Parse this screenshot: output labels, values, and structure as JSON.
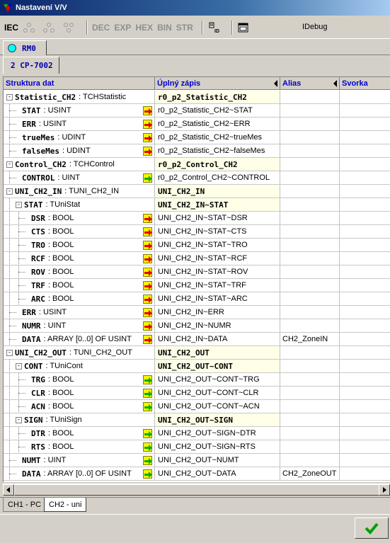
{
  "window": {
    "title": "Nastavení V/V"
  },
  "toolbar": {
    "iec": "IEC",
    "dec": "DEC",
    "exp": "EXP",
    "hex": "HEX",
    "bin": "BIN",
    "str": "STR",
    "idebug": "IDebug"
  },
  "rm_tab": {
    "label": "RM0",
    "led_color": "#00ffff"
  },
  "module_tab": {
    "label": "2 CP-7002"
  },
  "columns": {
    "structure": "Struktura dat",
    "full": "Úplný zápis",
    "alias": "Alias",
    "terminal": "Svorka"
  },
  "rows": [
    {
      "name": "Statistic_CH2",
      "type": ": TCHStatistic",
      "full": "r0_p2_Statistic_CH2",
      "alias": "",
      "level": 0,
      "expand": "-",
      "struct": true
    },
    {
      "name": "STAT",
      "type": ": USINT",
      "full": "r0_p2_Statistic_CH2~STAT",
      "alias": "",
      "level": 1,
      "io": "in"
    },
    {
      "name": "ERR",
      "type": ": USINT",
      "full": "r0_p2_Statistic_CH2~ERR",
      "alias": "",
      "level": 1,
      "io": "in"
    },
    {
      "name": "trueMes",
      "type": ": UDINT",
      "full": "r0_p2_Statistic_CH2~trueMes",
      "alias": "",
      "level": 1,
      "io": "in"
    },
    {
      "name": "falseMes",
      "type": ": UDINT",
      "full": "r0_p2_Statistic_CH2~falseMes",
      "alias": "",
      "level": 1,
      "io": "in"
    },
    {
      "name": "Control_CH2",
      "type": ": TCHControl",
      "full": "r0_p2_Control_CH2",
      "alias": "",
      "level": 0,
      "expand": "-",
      "struct": true
    },
    {
      "name": "CONTROL",
      "type": ": UINT",
      "full": "r0_p2_Control_CH2~CONTROL",
      "alias": "",
      "level": 1,
      "io": "out"
    },
    {
      "name": "UNI_CH2_IN",
      "type": ": TUNI_CH2_IN",
      "full": "UNI_CH2_IN",
      "alias": "",
      "level": 0,
      "expand": "-",
      "struct": true
    },
    {
      "name": "STAT",
      "type": ": TUniStat",
      "full": "UNI_CH2_IN~STAT",
      "alias": "",
      "level": 1,
      "expand": "-",
      "struct": true
    },
    {
      "name": "DSR",
      "type": ": BOOL",
      "full": "UNI_CH2_IN~STAT~DSR",
      "alias": "",
      "level": 2,
      "io": "in"
    },
    {
      "name": "CTS",
      "type": ": BOOL",
      "full": "UNI_CH2_IN~STAT~CTS",
      "alias": "",
      "level": 2,
      "io": "in"
    },
    {
      "name": "TRO",
      "type": ": BOOL",
      "full": "UNI_CH2_IN~STAT~TRO",
      "alias": "",
      "level": 2,
      "io": "in"
    },
    {
      "name": "RCF",
      "type": ": BOOL",
      "full": "UNI_CH2_IN~STAT~RCF",
      "alias": "",
      "level": 2,
      "io": "in"
    },
    {
      "name": "ROV",
      "type": ": BOOL",
      "full": "UNI_CH2_IN~STAT~ROV",
      "alias": "",
      "level": 2,
      "io": "in"
    },
    {
      "name": "TRF",
      "type": ": BOOL",
      "full": "UNI_CH2_IN~STAT~TRF",
      "alias": "",
      "level": 2,
      "io": "in"
    },
    {
      "name": "ARC",
      "type": ": BOOL",
      "full": "UNI_CH2_IN~STAT~ARC",
      "alias": "",
      "level": 2,
      "io": "in"
    },
    {
      "name": "ERR",
      "type": ": USINT",
      "full": "UNI_CH2_IN~ERR",
      "alias": "",
      "level": 1,
      "io": "in"
    },
    {
      "name": "NUMR",
      "type": ": UINT",
      "full": "UNI_CH2_IN~NUMR",
      "alias": "",
      "level": 1,
      "io": "in"
    },
    {
      "name": "DATA",
      "type": ": ARRAY [0..0] OF USINT",
      "full": "UNI_CH2_IN~DATA",
      "alias": "CH2_ZoneIN",
      "level": 1,
      "io": "in"
    },
    {
      "name": "UNI_CH2_OUT",
      "type": ": TUNI_CH2_OUT",
      "full": "UNI_CH2_OUT",
      "alias": "",
      "level": 0,
      "expand": "-",
      "struct": true
    },
    {
      "name": "CONT",
      "type": ": TUniCont",
      "full": "UNI_CH2_OUT~CONT",
      "alias": "",
      "level": 1,
      "expand": "-",
      "struct": true
    },
    {
      "name": "TRG",
      "type": ": BOOL",
      "full": "UNI_CH2_OUT~CONT~TRG",
      "alias": "",
      "level": 2,
      "io": "out"
    },
    {
      "name": "CLR",
      "type": ": BOOL",
      "full": "UNI_CH2_OUT~CONT~CLR",
      "alias": "",
      "level": 2,
      "io": "out"
    },
    {
      "name": "ACN",
      "type": ": BOOL",
      "full": "UNI_CH2_OUT~CONT~ACN",
      "alias": "",
      "level": 2,
      "io": "out"
    },
    {
      "name": "SIGN",
      "type": ": TUniSign",
      "full": "UNI_CH2_OUT~SIGN",
      "alias": "",
      "level": 1,
      "expand": "-",
      "struct": true
    },
    {
      "name": "DTR",
      "type": ": BOOL",
      "full": "UNI_CH2_OUT~SIGN~DTR",
      "alias": "",
      "level": 2,
      "io": "out"
    },
    {
      "name": "RTS",
      "type": ": BOOL",
      "full": "UNI_CH2_OUT~SIGN~RTS",
      "alias": "",
      "level": 2,
      "io": "out"
    },
    {
      "name": "NUMT",
      "type": ": UINT",
      "full": "UNI_CH2_OUT~NUMT",
      "alias": "",
      "level": 1,
      "io": "out"
    },
    {
      "name": "DATA",
      "type": ": ARRAY [0..0] OF USINT",
      "full": "UNI_CH2_OUT~DATA",
      "alias": "CH2_ZoneOUT",
      "level": 1,
      "io": "out"
    }
  ],
  "bottom_tabs": [
    {
      "label": "CH1 - PC"
    },
    {
      "label": "CH2 - uni"
    }
  ],
  "colors": {
    "in_arrow": "#e00000",
    "out_arrow": "#00b000",
    "io_box": "#f7f400",
    "struct_bg": "#ffffe8"
  }
}
